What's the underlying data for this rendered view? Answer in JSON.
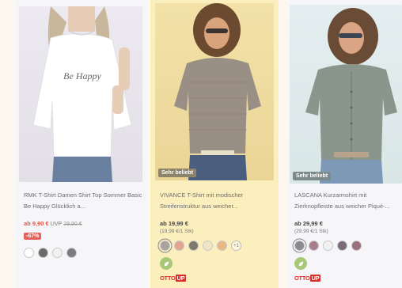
{
  "products": [
    {
      "title": "RMK T-Shirt Damen Shirt Top Sommer Basic Be Happy Glücklich a...",
      "price": "ab 9,90 €",
      "uvp_label": "UVP",
      "uvp_price": "29,90 €",
      "discount": "-67%",
      "shirt_text": "Be Happy",
      "swatches": [
        "#ffffff",
        "#6b6b6e",
        "#f1f1f3",
        "#7b7b80"
      ]
    },
    {
      "badge": "Sehr beliebt",
      "title": "VIVANCE T-Shirt mit modischer Streifenstruktur aus weicher...",
      "price": "ab 19,99 €",
      "unit_price": "(19,99 €/1 Stk)",
      "swatches": [
        "#a9a39a",
        "#e3a58f",
        "#7c7a6b",
        "#efe6c4",
        "#e9b783"
      ],
      "more_colors": "+1",
      "otto_up": "OTTO",
      "otto_up_tag": "UP"
    },
    {
      "badge": "Sehr beliebt",
      "title": "LASCANA Kurzarmshirt mit Zierknopfleiste aus weicher Piqué-...",
      "price": "ab 29,99 €",
      "unit_price": "(29,99 €/1 Stk)",
      "swatches": [
        "#8a8a90",
        "#a97d8e",
        "#f1f1f3",
        "#7b6a79",
        "#9b6f7e"
      ],
      "otto_up": "OTTO",
      "otto_up_tag": "UP"
    }
  ],
  "icons": {
    "eco": "leaf-icon"
  },
  "colors": {
    "sale": "#e05a4a",
    "highlight": "#fbefbe",
    "otto_red": "#d5302a"
  }
}
